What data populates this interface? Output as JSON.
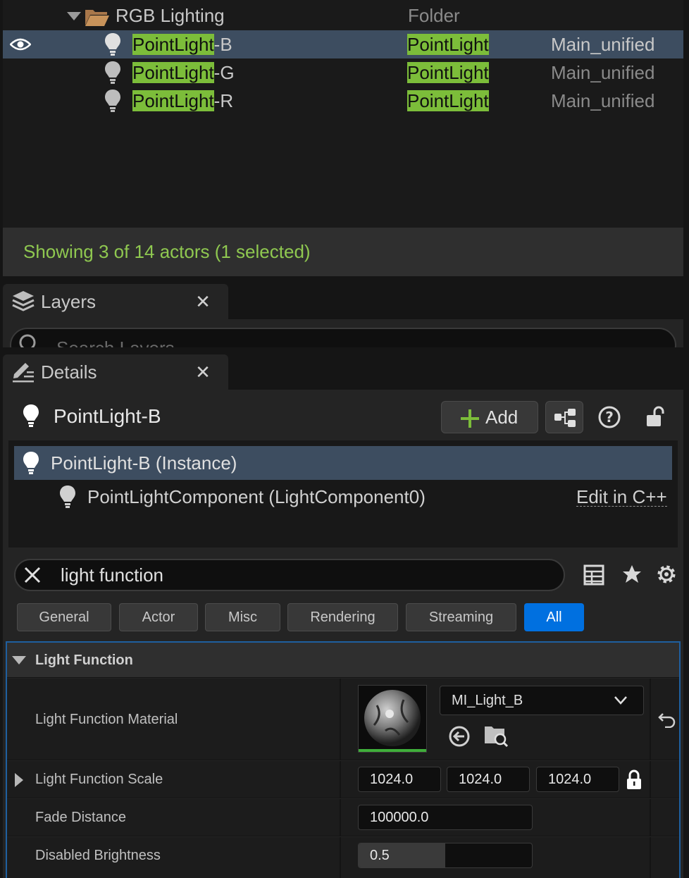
{
  "outliner": {
    "folder": {
      "name": "RGB Lighting",
      "type": "Folder"
    },
    "rows": [
      {
        "prefix": "PointLight",
        "suffix": "-B",
        "type": "PointLight",
        "level": "Main_unified",
        "selected": true
      },
      {
        "prefix": "PointLight",
        "suffix": "-G",
        "type": "PointLight",
        "level": "Main_unified",
        "selected": false
      },
      {
        "prefix": "PointLight",
        "suffix": "-R",
        "type": "PointLight",
        "level": "Main_unified",
        "selected": false
      }
    ],
    "status": "Showing 3 of 14 actors (1 selected)"
  },
  "layers": {
    "tab_label": "Layers",
    "search_placeholder": "Search Layers"
  },
  "details": {
    "tab_label": "Details",
    "actor_name": "PointLight-B",
    "add_label": "Add",
    "components": [
      {
        "label": "PointLight-B (Instance)"
      },
      {
        "label": "PointLightComponent (LightComponent0)",
        "action": "Edit in C++"
      }
    ],
    "search_value": "light function",
    "filters": [
      "General",
      "Actor",
      "Misc",
      "Rendering",
      "Streaming",
      "All"
    ],
    "active_filter": "All",
    "category": "Light Function",
    "properties": {
      "material": {
        "name": "Light Function Material",
        "value": "MI_Light_B"
      },
      "scale": {
        "name": "Light Function Scale",
        "x": "1024.0",
        "y": "1024.0",
        "z": "1024.0"
      },
      "fade": {
        "name": "Fade Distance",
        "value": "100000.0"
      },
      "brightness": {
        "name": "Disabled Brightness",
        "value": "0.5",
        "fraction": 0.5
      }
    }
  },
  "colors": {
    "highlight": "#7cbd3a",
    "selection": "#3d4d60",
    "accent": "#0070e0",
    "status": "#8fc850"
  }
}
